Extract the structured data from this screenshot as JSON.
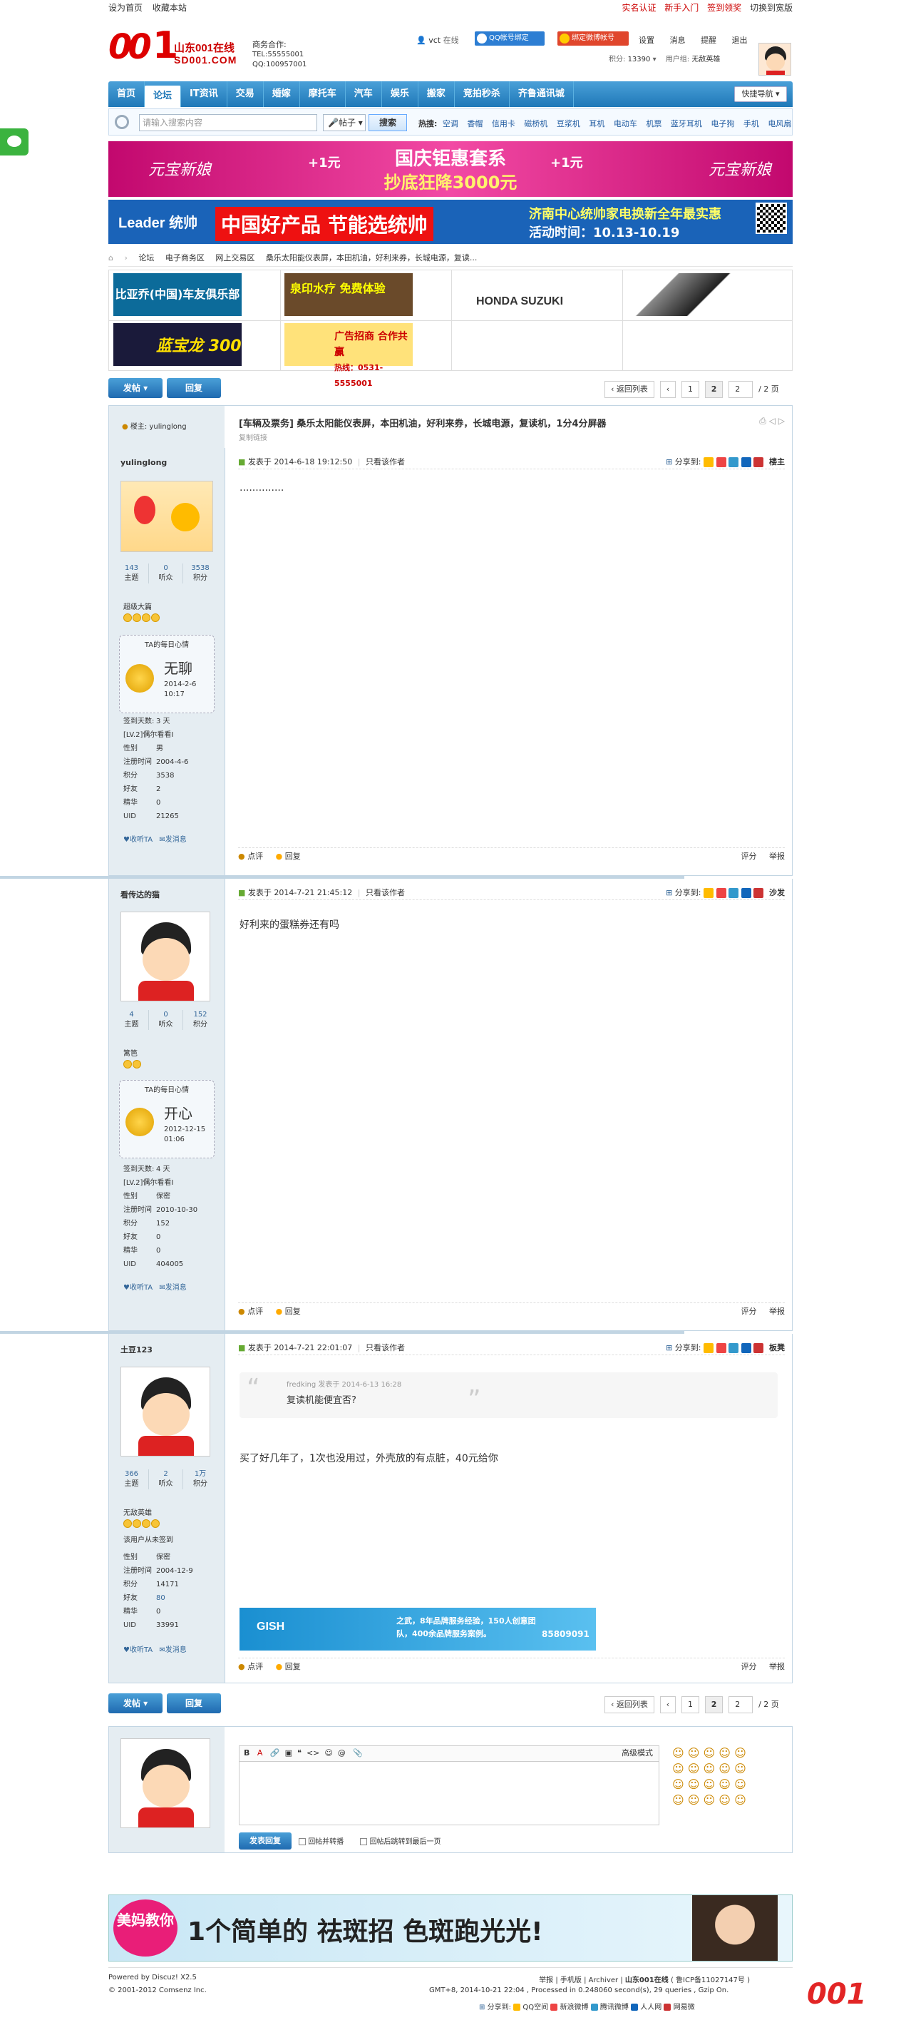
{
  "topbar": {
    "left": [
      "设为首页",
      "收藏本站"
    ],
    "right": [
      "实名认证",
      "新手入门",
      "签到领奖",
      "切换到宽版"
    ]
  },
  "header": {
    "logo_text": "山东001在线",
    "logo_sub": "SD001.COM",
    "contact_title": "商务合作:",
    "tel": "TEL:55555001",
    "qq": "QQ:100957001",
    "user": "vct",
    "status": "在线",
    "qq_bind": "QQ帐号绑定",
    "weibo_bind": "绑定微博帐号",
    "links": [
      "设置",
      "消息",
      "提醒",
      "退出"
    ],
    "points_label": "积分:",
    "points": "13390",
    "group_label": "用户组:",
    "group": "无敌英雄"
  },
  "nav": {
    "items": [
      "首页",
      "论坛",
      "IT资讯",
      "交易",
      "婚嫁",
      "摩托车",
      "汽车",
      "娱乐",
      "搬家",
      "竞拍秒杀",
      "齐鲁通讯城"
    ],
    "quick": "快捷导航"
  },
  "search": {
    "placeholder": "请输入搜索内容",
    "scope": "帖子",
    "button": "搜索",
    "hot_label": "热搜:",
    "hot": [
      "空调",
      "香帽",
      "信用卡",
      "磁桥机",
      "豆浆机",
      "耳机",
      "电动车",
      "机票",
      "蓝牙耳机",
      "电子狗",
      "手机",
      "电风扇"
    ]
  },
  "banners": {
    "b1_a": "元宝新娘",
    "b1_main": "国庆钜惠套系",
    "b1_sub": "抄底狂降3000元",
    "b1_plus1": "+1元",
    "b1_plus2": "+1元",
    "b2_brand": "Leader 统帅",
    "b2_main": "中国好产品 节能选统帅",
    "b2_right": "济南中心统帅家电换新全年最实惠",
    "b2_date": "活动时间：10.13-10.19"
  },
  "crumb": [
    "论坛",
    "电子商务区",
    "网上交易区",
    "桑乐太阳能仪表屏，本田机油，好利来券，长城电源，复读..."
  ],
  "ads": {
    "a1": "比亚乔(中国)车友俱乐部",
    "a2": "泉印水疗 免费体验",
    "a3": "HONDA  SUZUKI",
    "a5": "蓝宝龙 300",
    "a6": "广告招商 合作共赢",
    "a6_tel": "热线：0531-5555001"
  },
  "actions": {
    "post": "发帖",
    "reply": "回复",
    "back": "返回列表",
    "pages": [
      "1",
      "2"
    ],
    "page_input": "2",
    "page_total": "/ 2 页"
  },
  "thread": {
    "viewers_label": "楼主:",
    "owner": "yulinglong",
    "title": "[车辆及票务] 桑乐太阳能仪表屏，本田机油，好利来券，长城电源，复读机，1分4分屏器",
    "copy": "复制链接"
  },
  "posts": [
    {
      "user": "yulinglong",
      "stats": [
        {
          "v": "143",
          "k": "主题"
        },
        {
          "v": "0",
          "k": "听众"
        },
        {
          "v": "3538",
          "k": "积分"
        }
      ],
      "rank": "超级大篇",
      "mood_title": "TA的每日心情",
      "mood": "无聊",
      "mood_time": "2014-2-6 10:17",
      "info": [
        [
          "签到天数:",
          "3 天"
        ],
        [
          "[LV.2]偶尔看看I",
          ""
        ],
        [
          "性别",
          "男"
        ],
        [
          "注册时间",
          "2004-4-6"
        ],
        [
          "积分",
          "3538"
        ],
        [
          "好友",
          "2"
        ],
        [
          "精华",
          "0"
        ],
        [
          "UID",
          "21265"
        ]
      ],
      "follow": "收听TA",
      "msg": "发消息",
      "meta": "发表于 2014-6-18 19:12:50",
      "only": "只看该作者",
      "share": "分享到:",
      "floor": "楼主",
      "body": "..............",
      "rate": "点评",
      "reply": "回复",
      "score": "评分",
      "report": "举报"
    },
    {
      "user": "看传达的猫",
      "stats": [
        {
          "v": "4",
          "k": "主题"
        },
        {
          "v": "0",
          "k": "听众"
        },
        {
          "v": "152",
          "k": "积分"
        }
      ],
      "rank": "篱笆",
      "mood_title": "TA的每日心情",
      "mood": "开心",
      "mood_time": "2012-12-15 01:06",
      "info": [
        [
          "签到天数:",
          "4 天"
        ],
        [
          "[LV.2]偶尔看看I",
          ""
        ],
        [
          "性别",
          "保密"
        ],
        [
          "注册时间",
          "2010-10-30"
        ],
        [
          "积分",
          "152"
        ],
        [
          "好友",
          "0"
        ],
        [
          "精华",
          "0"
        ],
        [
          "UID",
          "404005"
        ]
      ],
      "follow": "收听TA",
      "msg": "发消息",
      "meta": "发表于 2014-7-21 21:45:12",
      "only": "只看该作者",
      "share": "分享到:",
      "floor": "沙发",
      "body": "好利来的蛋糕券还有吗",
      "rate": "点评",
      "reply": "回复",
      "score": "评分",
      "report": "举报"
    },
    {
      "user": "土豆123",
      "stats": [
        {
          "v": "366",
          "k": "主题"
        },
        {
          "v": "2",
          "k": "听众"
        },
        {
          "v": "1万",
          "k": "积分"
        }
      ],
      "rank": "无敌英雄",
      "sign": "该用户从未签到",
      "info": [
        [
          "性别",
          "保密"
        ],
        [
          "注册时间",
          "2004-12-9"
        ],
        [
          "积分",
          "14171"
        ],
        [
          "好友",
          "80"
        ],
        [
          "精华",
          "0"
        ],
        [
          "UID",
          "33991"
        ]
      ],
      "follow": "收听TA",
      "msg": "发消息",
      "meta": "发表于 2014-7-21 22:01:07",
      "only": "只看该作者",
      "share": "分享到:",
      "floor": "板凳",
      "quote_meta": "fredking 发表于 2014-6-13 16:28",
      "quote": "复读机能便宜否?",
      "body": "买了好几年了，1次也没用过，外壳放的有点脏，40元给你",
      "ad": "之武，8年品牌服务经验，150人创意团队，400余品牌服务案例。",
      "ad_tel": "85809091",
      "rate": "点评",
      "reply": "回复",
      "score": "评分",
      "report": "举报"
    }
  ],
  "editor": {
    "advanced": "高级模式",
    "submit": "发表回复",
    "opt1": "回帖并转播",
    "opt2": "回帖后跳转到最后一页"
  },
  "bottom_banner": {
    "a": "美妈教你",
    "b": "1个简单的 祛斑招 色斑跑光光!"
  },
  "footer": {
    "powered": "Powered by Discuz! X2.5",
    "copy": "© 2001-2012 Comsenz Inc.",
    "links": [
      "举报",
      "手机版",
      "Archiver",
      "山东001在线",
      "( 鲁ICP备11027147号 )"
    ],
    "stat": "GMT+8, 2014-10-21 22:04 , Processed in 0.248060 second(s), 29 queries , Gzip On.",
    "share_label": "分享到:",
    "share": [
      "QQ空间",
      "新浪微博",
      "腾讯微博",
      "人人网",
      "网易微"
    ]
  },
  "colors": {
    "nav": "#1f78b8",
    "side": "#e5edf2",
    "border": "#c2d5e3"
  }
}
